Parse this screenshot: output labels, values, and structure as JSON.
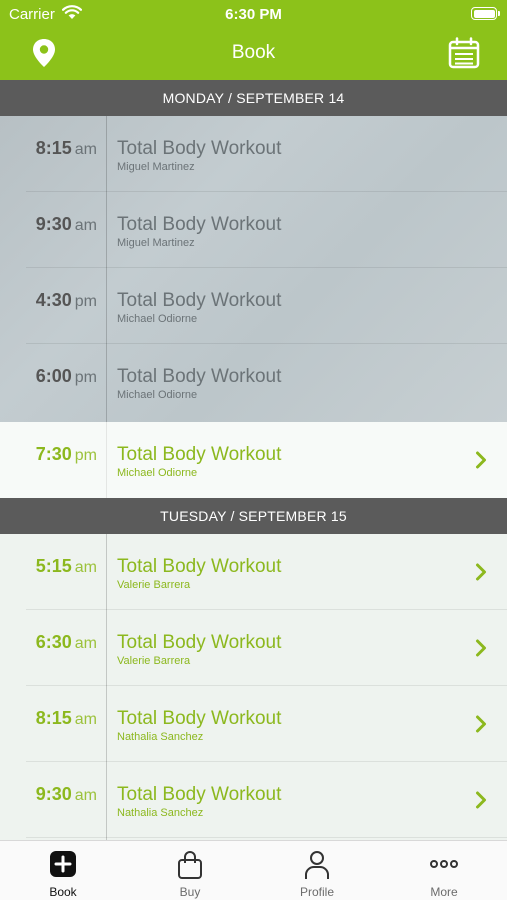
{
  "status": {
    "carrier": "Carrier",
    "time": "6:30 PM"
  },
  "nav": {
    "title": "Book",
    "left_icon": "location-pin-icon",
    "right_icon": "calendar-icon"
  },
  "colors": {
    "accent": "#8cc21a",
    "header_bg": "#5b5b5b"
  },
  "days": [
    {
      "header": "MONDAY / SEPTEMBER 14",
      "classes": [
        {
          "hm": "8:15",
          "ap": "am",
          "title": "Total Body Workout",
          "instructor": "Miguel Martinez",
          "state": "past"
        },
        {
          "hm": "9:30",
          "ap": "am",
          "title": "Total Body Workout",
          "instructor": "Miguel Martinez",
          "state": "past"
        },
        {
          "hm": "4:30",
          "ap": "pm",
          "title": "Total Body Workout",
          "instructor": "Michael Odiorne",
          "state": "past"
        },
        {
          "hm": "6:00",
          "ap": "pm",
          "title": "Total Body Workout",
          "instructor": "Michael Odiorne",
          "state": "past"
        },
        {
          "hm": "7:30",
          "ap": "pm",
          "title": "Total Body Workout",
          "instructor": "Michael Odiorne",
          "state": "available"
        }
      ]
    },
    {
      "header": "TUESDAY / SEPTEMBER 15",
      "classes": [
        {
          "hm": "5:15",
          "ap": "am",
          "title": "Total Body Workout",
          "instructor": "Valerie Barrera",
          "state": "available"
        },
        {
          "hm": "6:30",
          "ap": "am",
          "title": "Total Body Workout",
          "instructor": "Valerie Barrera",
          "state": "available"
        },
        {
          "hm": "8:15",
          "ap": "am",
          "title": "Total Body Workout",
          "instructor": "Nathalia Sanchez",
          "state": "available"
        },
        {
          "hm": "9:30",
          "ap": "am",
          "title": "Total Body Workout",
          "instructor": "Nathalia Sanchez",
          "state": "available"
        }
      ]
    }
  ],
  "tabs": [
    {
      "label": "Book",
      "icon": "book-plus-icon",
      "active": true
    },
    {
      "label": "Buy",
      "icon": "shopping-bag-icon",
      "active": false
    },
    {
      "label": "Profile",
      "icon": "person-icon",
      "active": false
    },
    {
      "label": "More",
      "icon": "more-dots-icon",
      "active": false
    }
  ]
}
